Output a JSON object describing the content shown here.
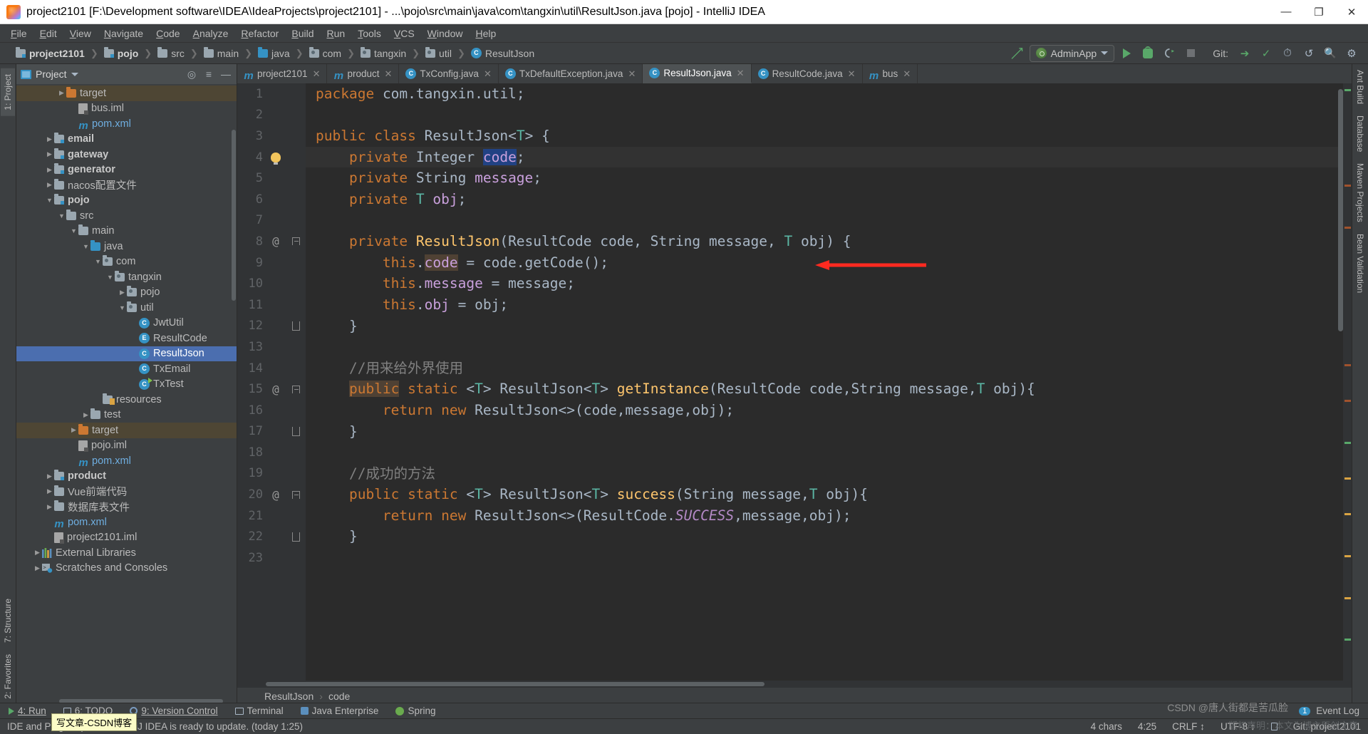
{
  "window": {
    "title": "project2101 [F:\\Development software\\IDEA\\IdeaProjects\\project2101] - ...\\pojo\\src\\main\\java\\com\\tangxin\\util\\ResultJson.java [pojo] - IntelliJ IDEA",
    "minimize": "—",
    "maximize": "❐",
    "close": "✕"
  },
  "menu": [
    "File",
    "Edit",
    "View",
    "Navigate",
    "Code",
    "Analyze",
    "Refactor",
    "Build",
    "Run",
    "Tools",
    "VCS",
    "Window",
    "Help"
  ],
  "navbar": {
    "crumbs": [
      {
        "label": "project2101",
        "icon": "folder-module-icon",
        "bold": true
      },
      {
        "label": "pojo",
        "icon": "folder-module-icon",
        "bold": true
      },
      {
        "label": "src",
        "icon": "folder-icon",
        "bold": false
      },
      {
        "label": "main",
        "icon": "folder-icon",
        "bold": false
      },
      {
        "label": "java",
        "icon": "folder-source-icon",
        "bold": false
      },
      {
        "label": "com",
        "icon": "folder-package-icon",
        "bold": false
      },
      {
        "label": "tangxin",
        "icon": "folder-package-icon",
        "bold": false
      },
      {
        "label": "util",
        "icon": "folder-package-icon",
        "bold": false
      },
      {
        "label": "ResultJson",
        "icon": "class-icon",
        "bold": false
      }
    ],
    "run_config": "AdminApp",
    "git_label": "Git:"
  },
  "project_panel": {
    "header_title": "Project",
    "tree": [
      {
        "label": "target",
        "depth": 3,
        "arrow": "right",
        "icon": "folder-orange-icon",
        "bold": false,
        "highlight": "target"
      },
      {
        "label": "bus.iml",
        "depth": 4,
        "arrow": "none",
        "icon": "iml-icon",
        "bold": false
      },
      {
        "label": "pom.xml",
        "depth": 4,
        "arrow": "none",
        "icon": "maven-icon",
        "bold": false,
        "blue": true
      },
      {
        "label": "email",
        "depth": 2,
        "arrow": "right",
        "icon": "folder-module-icon",
        "bold": true
      },
      {
        "label": "gateway",
        "depth": 2,
        "arrow": "right",
        "icon": "folder-module-icon",
        "bold": true
      },
      {
        "label": "generator",
        "depth": 2,
        "arrow": "right",
        "icon": "folder-module-icon",
        "bold": true
      },
      {
        "label": "nacos配置文件",
        "depth": 2,
        "arrow": "right",
        "icon": "folder-icon",
        "bold": false
      },
      {
        "label": "pojo",
        "depth": 2,
        "arrow": "down",
        "icon": "folder-module-icon",
        "bold": true
      },
      {
        "label": "src",
        "depth": 3,
        "arrow": "down",
        "icon": "folder-icon",
        "bold": false
      },
      {
        "label": "main",
        "depth": 4,
        "arrow": "down",
        "icon": "folder-icon",
        "bold": false
      },
      {
        "label": "java",
        "depth": 5,
        "arrow": "down",
        "icon": "folder-source-icon",
        "bold": false
      },
      {
        "label": "com",
        "depth": 6,
        "arrow": "down",
        "icon": "folder-package-icon",
        "bold": false
      },
      {
        "label": "tangxin",
        "depth": 7,
        "arrow": "down",
        "icon": "folder-package-icon",
        "bold": false
      },
      {
        "label": "pojo",
        "depth": 8,
        "arrow": "right",
        "icon": "folder-package-icon",
        "bold": false
      },
      {
        "label": "util",
        "depth": 8,
        "arrow": "down",
        "icon": "folder-package-icon",
        "bold": false
      },
      {
        "label": "JwtUtil",
        "depth": 9,
        "arrow": "none",
        "icon": "class-icon",
        "bold": false
      },
      {
        "label": "ResultCode",
        "depth": 9,
        "arrow": "none",
        "icon": "enum-icon",
        "bold": false
      },
      {
        "label": "ResultJson",
        "depth": 9,
        "arrow": "none",
        "icon": "class-icon",
        "bold": false,
        "selected": true
      },
      {
        "label": "TxEmail",
        "depth": 9,
        "arrow": "none",
        "icon": "class-icon",
        "bold": false
      },
      {
        "label": "TxTest",
        "depth": 9,
        "arrow": "none",
        "icon": "class-runnable-icon",
        "bold": false
      },
      {
        "label": "resources",
        "depth": 6,
        "arrow": "none",
        "icon": "folder-resources-icon",
        "bold": false
      },
      {
        "label": "test",
        "depth": 5,
        "arrow": "right",
        "icon": "folder-icon",
        "bold": false
      },
      {
        "label": "target",
        "depth": 4,
        "arrow": "right",
        "icon": "folder-orange-icon",
        "bold": false,
        "highlight": "target"
      },
      {
        "label": "pojo.iml",
        "depth": 4,
        "arrow": "none",
        "icon": "iml-icon",
        "bold": false
      },
      {
        "label": "pom.xml",
        "depth": 4,
        "arrow": "none",
        "icon": "maven-icon",
        "bold": false,
        "blue": true
      },
      {
        "label": "product",
        "depth": 2,
        "arrow": "right",
        "icon": "folder-module-icon",
        "bold": true
      },
      {
        "label": "Vue前端代码",
        "depth": 2,
        "arrow": "right",
        "icon": "folder-icon",
        "bold": false
      },
      {
        "label": "数据库表文件",
        "depth": 2,
        "arrow": "right",
        "icon": "folder-icon",
        "bold": false
      },
      {
        "label": "pom.xml",
        "depth": 2,
        "arrow": "none",
        "icon": "maven-icon",
        "bold": false,
        "blue": true
      },
      {
        "label": "project2101.iml",
        "depth": 2,
        "arrow": "none",
        "icon": "iml-icon",
        "bold": false
      },
      {
        "label": "External Libraries",
        "depth": 1,
        "arrow": "right",
        "icon": "libraries-icon",
        "bold": false
      },
      {
        "label": "Scratches and Consoles",
        "depth": 1,
        "arrow": "right",
        "icon": "scratches-icon",
        "bold": false
      }
    ]
  },
  "left_rail": [
    {
      "label": "1: Project",
      "active": true
    },
    {
      "label": "7: Structure",
      "active": false
    },
    {
      "label": "2: Favorites",
      "active": false
    }
  ],
  "right_rail": [
    "Ant Build",
    "Database",
    "Maven Projects",
    "Bean Validation"
  ],
  "editor": {
    "tabs": [
      {
        "label": "project2101",
        "icon": "maven-icon",
        "active": false
      },
      {
        "label": "product",
        "icon": "maven-icon",
        "active": false
      },
      {
        "label": "TxConfig.java",
        "icon": "class-icon",
        "active": false
      },
      {
        "label": "TxDefaultException.java",
        "icon": "class-icon",
        "active": false
      },
      {
        "label": "ResultJson.java",
        "icon": "class-icon",
        "active": true
      },
      {
        "label": "ResultCode.java",
        "icon": "class-icon",
        "active": false
      },
      {
        "label": "bus",
        "icon": "maven-icon",
        "active": false
      }
    ],
    "breadcrumb": [
      "ResultJson",
      "code"
    ],
    "caret_line": 4,
    "lines": [
      {
        "n": 1,
        "marker": "",
        "fold": ""
      },
      {
        "n": 2,
        "marker": "",
        "fold": ""
      },
      {
        "n": 3,
        "marker": "",
        "fold": ""
      },
      {
        "n": 4,
        "marker": "bulb",
        "fold": ""
      },
      {
        "n": 5,
        "marker": "",
        "fold": ""
      },
      {
        "n": 6,
        "marker": "",
        "fold": ""
      },
      {
        "n": 7,
        "marker": "",
        "fold": ""
      },
      {
        "n": 8,
        "marker": "at",
        "fold": "top"
      },
      {
        "n": 9,
        "marker": "",
        "fold": ""
      },
      {
        "n": 10,
        "marker": "",
        "fold": ""
      },
      {
        "n": 11,
        "marker": "",
        "fold": ""
      },
      {
        "n": 12,
        "marker": "",
        "fold": "bottom"
      },
      {
        "n": 13,
        "marker": "",
        "fold": ""
      },
      {
        "n": 14,
        "marker": "",
        "fold": ""
      },
      {
        "n": 15,
        "marker": "at",
        "fold": "top"
      },
      {
        "n": 16,
        "marker": "",
        "fold": ""
      },
      {
        "n": 17,
        "marker": "",
        "fold": "bottom"
      },
      {
        "n": 18,
        "marker": "",
        "fold": ""
      },
      {
        "n": 19,
        "marker": "",
        "fold": ""
      },
      {
        "n": 20,
        "marker": "at",
        "fold": "top"
      },
      {
        "n": 21,
        "marker": "",
        "fold": ""
      },
      {
        "n": 22,
        "marker": "",
        "fold": "bottom"
      },
      {
        "n": 23,
        "marker": "",
        "fold": ""
      }
    ],
    "code_text": [
      "package com.tangxin.util;",
      "",
      "public class ResultJson<T> {",
      "    private Integer code;",
      "    private String message;",
      "    private T obj;",
      "",
      "    private ResultJson(ResultCode code, String message, T obj) {",
      "        this.code = code.getCode();",
      "        this.message = message;",
      "        this.obj = obj;",
      "    }",
      "",
      "    //用来给外界使用",
      "    public static <T> ResultJson<T> getInstance(ResultCode code,String message,T obj){",
      "        return new ResultJson<>(code,message,obj);",
      "    }",
      "",
      "    //成功的方法",
      "    public static <T> ResultJson<T> success(String message,T obj){",
      "        return new ResultJson<>(ResultCode.SUCCESS,message,obj);",
      "    }",
      ""
    ]
  },
  "tool_window_bar": {
    "items": [
      {
        "label": "4: Run",
        "icon": "run-icon"
      },
      {
        "label": "6: TODO",
        "icon": "todo-icon"
      },
      {
        "label": "9: Version Control",
        "icon": "vcs-icon"
      },
      {
        "label": "Terminal",
        "icon": "terminal-icon"
      },
      {
        "label": "Java Enterprise",
        "icon": "java-enterprise-icon"
      },
      {
        "label": "Spring",
        "icon": "spring-icon"
      }
    ],
    "event_log": "Event Log",
    "event_log_count": "1"
  },
  "status_bar": {
    "message": "IDE and Plugin Updates: IntelliJ IDEA is ready to update. (today 1:25)",
    "chars": "4 chars",
    "caret_position": "4:25",
    "line_separator": "CRLF ↕",
    "encoding": "UTF-8 ↕",
    "git_branch": "Git: project2101",
    "lock": "lock-icon"
  },
  "overlays": {
    "tooltip": "写文章-CSDN博客",
    "watermark_right": "CSDN @唐人街都是苦瓜脸",
    "watermark_bottom": "版权声明：本文为博主原创文章"
  },
  "colors": {
    "accent": "#4b6eaf",
    "keyword": "#cc7832",
    "field": "#c9a0dc",
    "method": "#ffc66d",
    "comment": "#808080",
    "generic": "#5bb6a4",
    "selection": "#214283",
    "annotation_arrow": "#ff2a20"
  }
}
